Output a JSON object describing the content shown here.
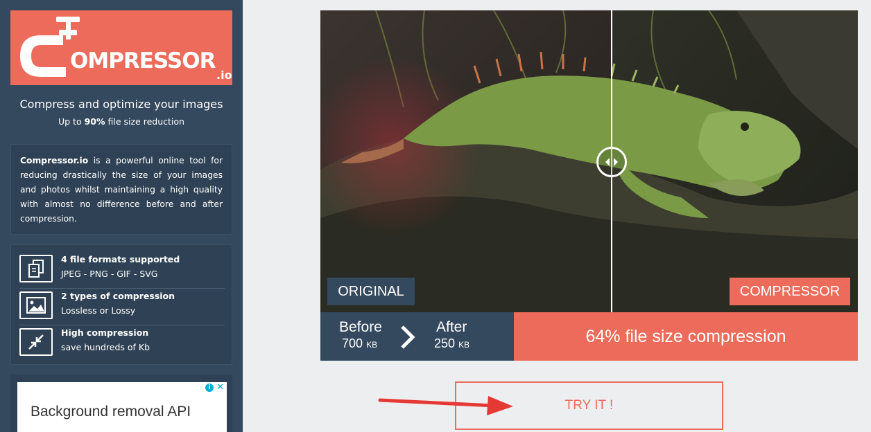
{
  "logo": {
    "word": "OMPRESSOR",
    "suffix": ".io"
  },
  "tagline": "Compress and optimize your images",
  "subtagline": {
    "prefix": "Up to ",
    "highlight": "90%",
    "suffix": " file size reduction"
  },
  "about": {
    "brand": "Compressor.io",
    "text": " is a powerful online tool for reducing drastically the size of your images and photos whilst maintaining a high quality with almost no difference before and after compression."
  },
  "features": [
    {
      "icon": "file-formats-icon",
      "title": "4 file formats supported",
      "subtitle": "JPEG - PNG - GIF - SVG"
    },
    {
      "icon": "image-icon",
      "title": "2 types of compression",
      "subtitle": "Lossless or Lossy"
    },
    {
      "icon": "compress-arrows-icon",
      "title": "High compression",
      "subtitle": "save hundreds of Kb"
    }
  ],
  "ad": {
    "text": "Background removal API",
    "info_icon": "i",
    "close_icon": "✕"
  },
  "comparison": {
    "left_tag": "ORIGINAL",
    "right_tag": "COMPRESSOR",
    "before_label": "Before",
    "before_value": "700",
    "before_unit": "KB",
    "after_label": "After",
    "after_value": "250",
    "after_unit": "KB",
    "ratio_text": "64% file size compression"
  },
  "cta": {
    "label": "TRY IT !"
  },
  "colors": {
    "brand": "#ec6b5a",
    "sidebar": "#34495e",
    "panel": "#2f4255",
    "background": "#edeef0"
  }
}
